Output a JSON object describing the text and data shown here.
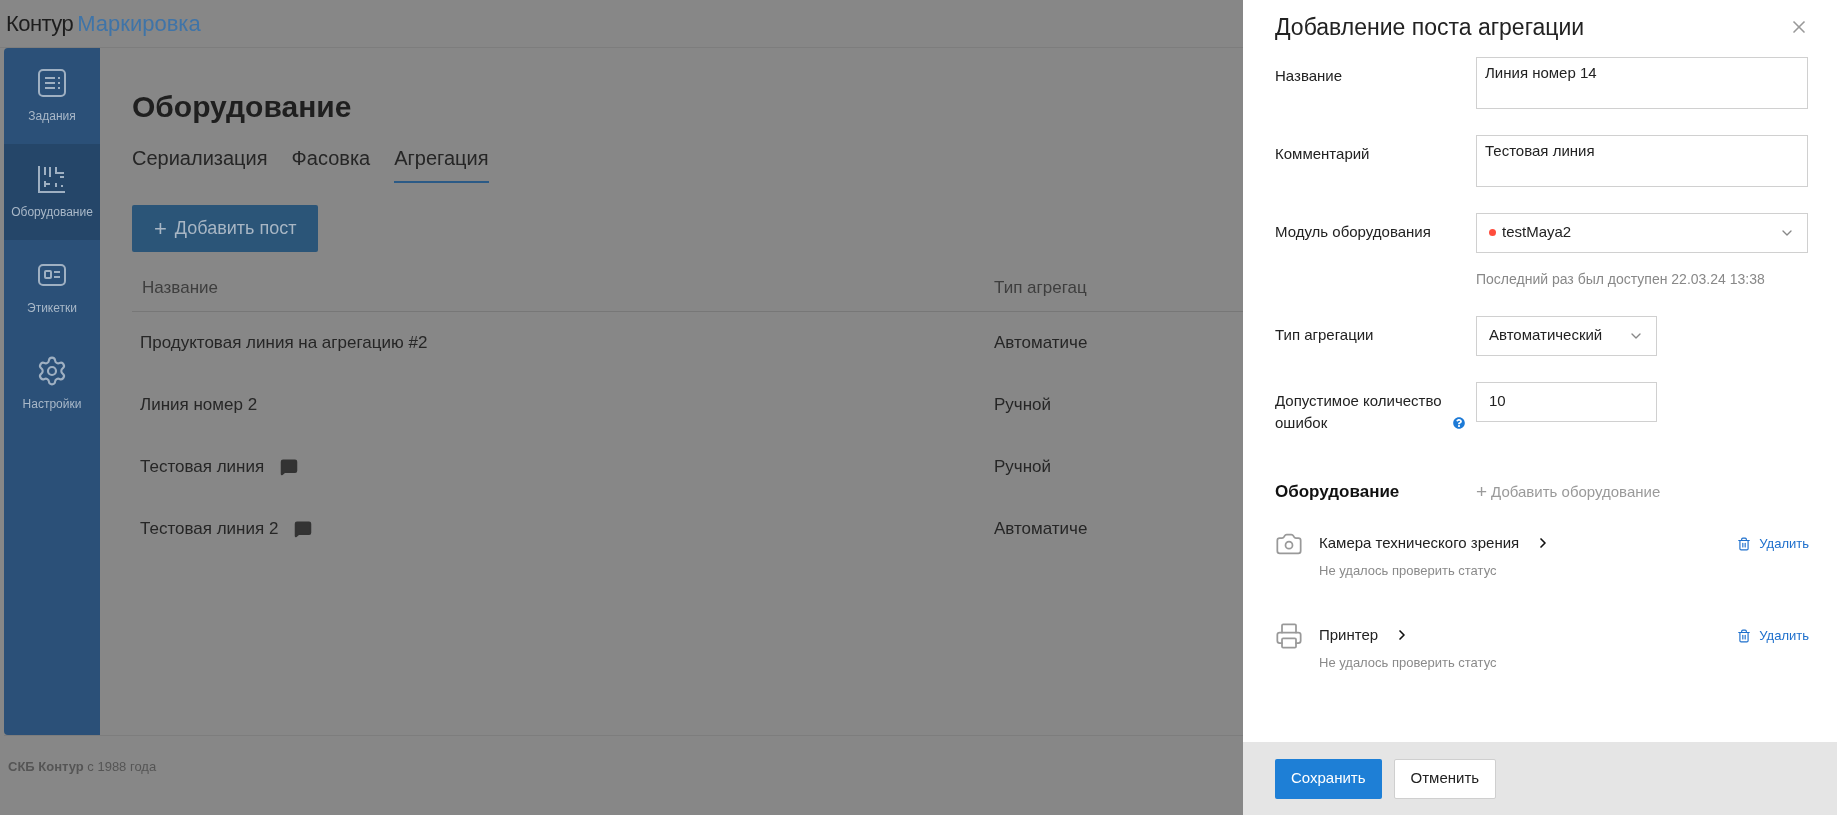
{
  "header": {
    "brand": "Контур",
    "product": "Маркировка"
  },
  "sidebar": {
    "items": [
      {
        "label": "Задания",
        "selected": false
      },
      {
        "label": "Оборудование",
        "selected": true
      },
      {
        "label": "Этикетки",
        "selected": false
      },
      {
        "label": "Настройки",
        "selected": false
      }
    ]
  },
  "page": {
    "title": "Оборудование",
    "tabs": [
      {
        "label": "Сериализация",
        "selected": false
      },
      {
        "label": "Фасовка",
        "selected": false
      },
      {
        "label": "Агрегация",
        "selected": true
      }
    ],
    "add_button": {
      "icon": "+",
      "label": "Добавить пост"
    },
    "table": {
      "columns": [
        "Название",
        "Тип агрегац"
      ],
      "rows": [
        {
          "cells": [
            "Продуктовая линия на агрегацию #2",
            "Автоматиче"
          ],
          "comment": false
        },
        {
          "cells": [
            "Линия номер 2",
            "Ручной"
          ],
          "comment": false
        },
        {
          "cells": [
            "Тестовая линия",
            "Ручной"
          ],
          "comment": true
        },
        {
          "cells": [
            "Тестовая линия 2",
            "Автоматиче"
          ],
          "comment": true
        }
      ]
    }
  },
  "footer": {
    "text": "**СКБ Контур** с 1988 года"
  },
  "panel": {
    "title": "Добавление поста агрегации",
    "fields": [
      {
        "kind": "textarea",
        "label": "Название",
        "value": "Линия номер 14"
      },
      {
        "kind": "textarea",
        "label": "Комментарий",
        "value": "Тестовая линия"
      },
      {
        "kind": "select",
        "label": "Модуль оборудования",
        "value": "testMaya2",
        "color": "#ff4d3d",
        "hint": "Последний раз был доступен 22.03.24 13:38",
        "wide": true
      },
      {
        "kind": "select",
        "label": "Тип агрегации",
        "value": "Автоматический",
        "wide": false
      },
      {
        "kind": "input",
        "label": "Допустимое количество ошибок",
        "value": "10",
        "help": true
      }
    ],
    "equipment": {
      "title": "Оборудование",
      "add_icon": "+",
      "add_label": "Добавить оборудование",
      "items": [
        {
          "name": "Камера технического зрения",
          "status": "Не удалось проверить статус",
          "remove_label": "Удалить"
        },
        {
          "name": "Принтер",
          "status": "Не удалось проверить статус",
          "remove_label": "Удалить"
        }
      ]
    },
    "buttons": {
      "save": "Сохранить",
      "cancel": "Отменить"
    }
  }
}
